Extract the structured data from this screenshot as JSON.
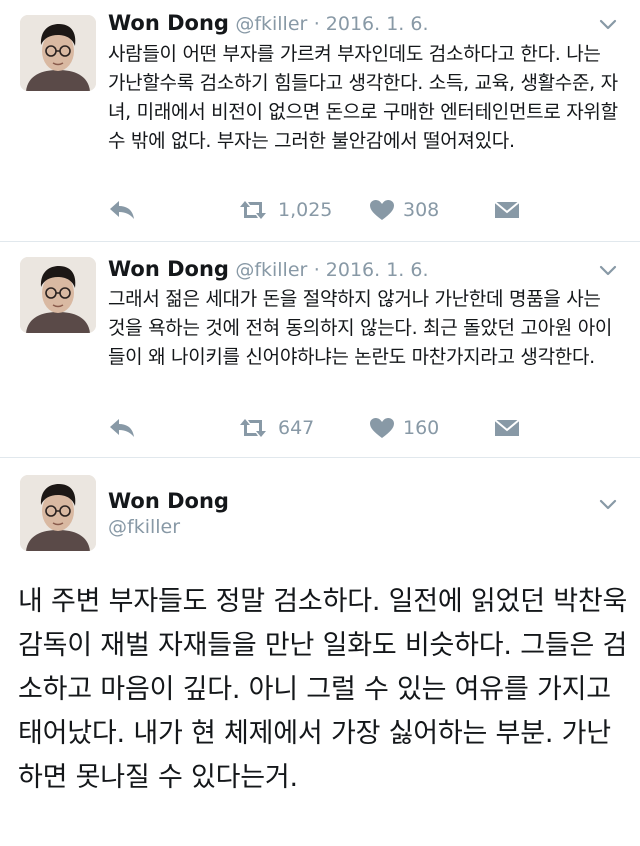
{
  "tweets": [
    {
      "name": "Won Dong",
      "handle": "@fkiller",
      "date": "· 2016. 1. 6.",
      "text": "사람들이 어떤 부자를 가르켜 부자인데도 검소하다고 한다. 나는 가난할수록 검소하기 힘들다고 생각한다. 소득, 교육, 생활수준, 자녀, 미래에서 비전이 없으면 돈으로 구매한 엔터테인먼트로 자위할 수 밖에 없다. 부자는 그러한 불안감에서 떨어져있다.",
      "retweets": "1,025",
      "likes": "308"
    },
    {
      "name": "Won Dong",
      "handle": "@fkiller",
      "date": "· 2016. 1. 6.",
      "text": "그래서 젊은 세대가 돈을 절약하지 않거나 가난한데 명품을 사는 것을 욕하는 것에 전혀 동의하지 않는다. 최근 돌았던 고아원 아이들이 왜 나이키를 신어야하냐는 논란도 마찬가지라고 생각한다.",
      "retweets": "647",
      "likes": "160"
    }
  ],
  "main_tweet": {
    "name": "Won Dong",
    "handle": "@fkiller",
    "text": "내 주변 부자들도 정말 검소하다. 일전에 읽었던 박찬욱 감독이 재벌 자재들을 만난 일화도 비슷하다. 그들은 검소하고 마음이 깊다. 아니 그럴 수 있는 여유를 가지고 태어났다. 내가 현 체제에서 가장 싫어하는 부분. 가난하면 못나질 수 있다는거."
  },
  "icons": {
    "reply": "reply-arrow-icon",
    "retweet": "retweet-icon",
    "like": "heart-icon",
    "dm": "envelope-icon",
    "menu": "chevron-down-icon"
  },
  "colors": {
    "text": "#14171a",
    "muted": "#8899a6",
    "divider": "#e1e8ed"
  }
}
